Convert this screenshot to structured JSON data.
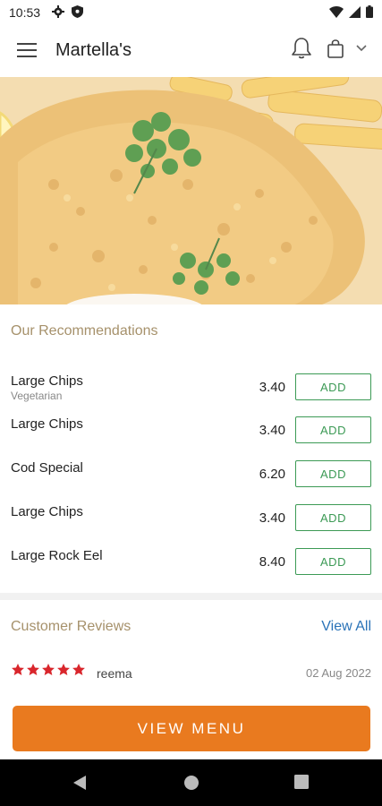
{
  "status_bar": {
    "time": "10:53",
    "icons_left": [
      "gear-icon",
      "shield-icon"
    ],
    "icons_right": [
      "wifi-icon",
      "signal-icon",
      "battery-icon"
    ]
  },
  "app_bar": {
    "title": "Martella's",
    "icons": [
      "menu-icon",
      "bell-icon",
      "shopping-bag-icon",
      "chevron-down-icon"
    ]
  },
  "hero": {
    "image": "fried-fish-and-chips-with-parsley"
  },
  "recommendations": {
    "title": "Our Recommendations",
    "add_label": "ADD",
    "items": [
      {
        "name": "Large Chips",
        "subtitle": "Vegetarian",
        "price": "3.40"
      },
      {
        "name": "Large Chips",
        "subtitle": "",
        "price": "3.40"
      },
      {
        "name": "Cod Special",
        "subtitle": "",
        "price": "6.20"
      },
      {
        "name": "Large Chips",
        "subtitle": "",
        "price": "3.40"
      },
      {
        "name": "Large Rock Eel",
        "subtitle": "",
        "price": "8.40"
      }
    ]
  },
  "reviews": {
    "title": "Customer Reviews",
    "view_all": "View All",
    "items": [
      {
        "rating": 5,
        "max_rating": 5,
        "name": "reema",
        "date": "02 Aug 2022"
      }
    ]
  },
  "cta": {
    "label": "VIEW MENU"
  },
  "colors": {
    "accent_orange": "#e97a1f",
    "add_green": "#3c9a55",
    "section_title": "#a6916b",
    "link_blue": "#2a73b8",
    "star_red": "#d9262c"
  },
  "nav_bar": {
    "icons": [
      "back-icon",
      "home-icon",
      "recents-icon"
    ]
  }
}
